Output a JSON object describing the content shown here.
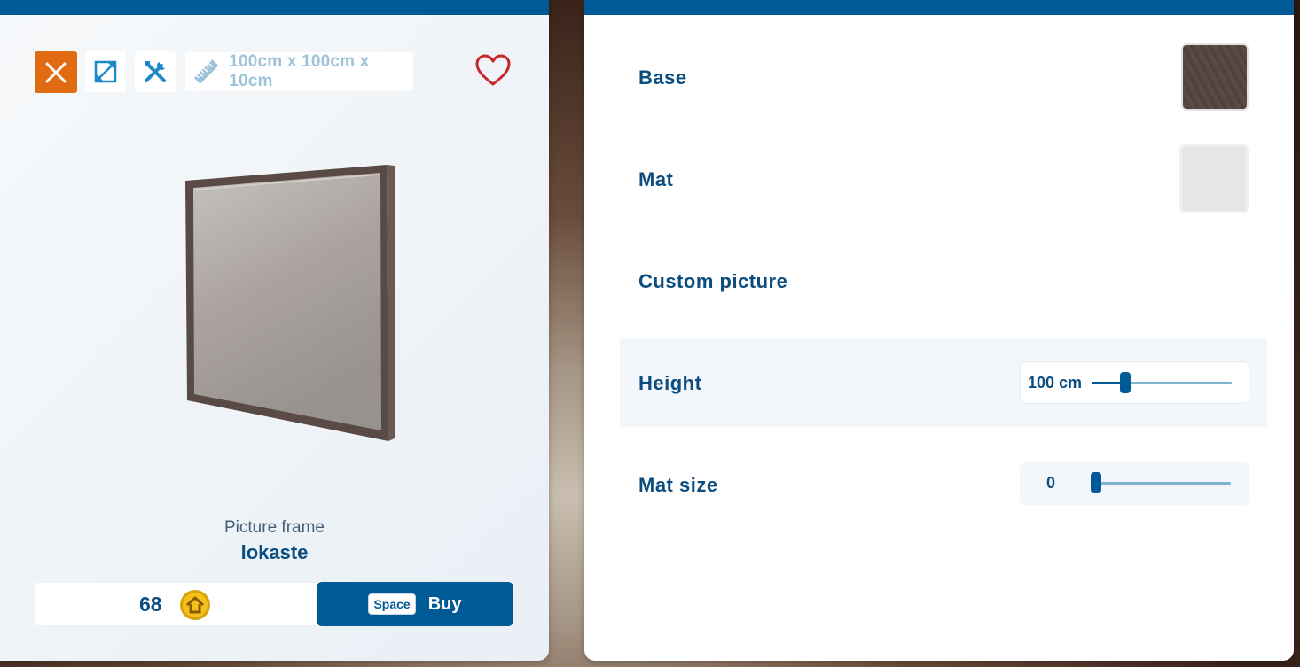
{
  "colors": {
    "accent": "#005a96",
    "close": "#e06b13",
    "heart": "#c62828",
    "text_primary": "#0c4d7f"
  },
  "toolbar": {
    "close_icon": "close-icon",
    "resize_icon": "resize-icon",
    "tools_icon": "tools-icon",
    "ruler_icon": "ruler-icon",
    "dimensions": "100cm x 100cm x 10cm",
    "favorite_icon": "heart-icon"
  },
  "item": {
    "category": "Picture frame",
    "name": "lokaste"
  },
  "purchase": {
    "price": "68",
    "currency_icon": "coin-house-icon",
    "key_hint": "Space",
    "buy_label": "Buy"
  },
  "options": {
    "base": {
      "label": "Base",
      "swatch_color": "#54463f"
    },
    "mat": {
      "label": "Mat",
      "swatch_color": "#e6e6e6"
    },
    "custom_picture": {
      "label": "Custom picture"
    },
    "height": {
      "label": "Height",
      "value_text": "100 cm",
      "value": 100,
      "slider_fraction": 0.24
    },
    "mat_size": {
      "label": "Mat size",
      "value_text": "0",
      "value": 0,
      "slider_fraction": 0.04
    }
  }
}
